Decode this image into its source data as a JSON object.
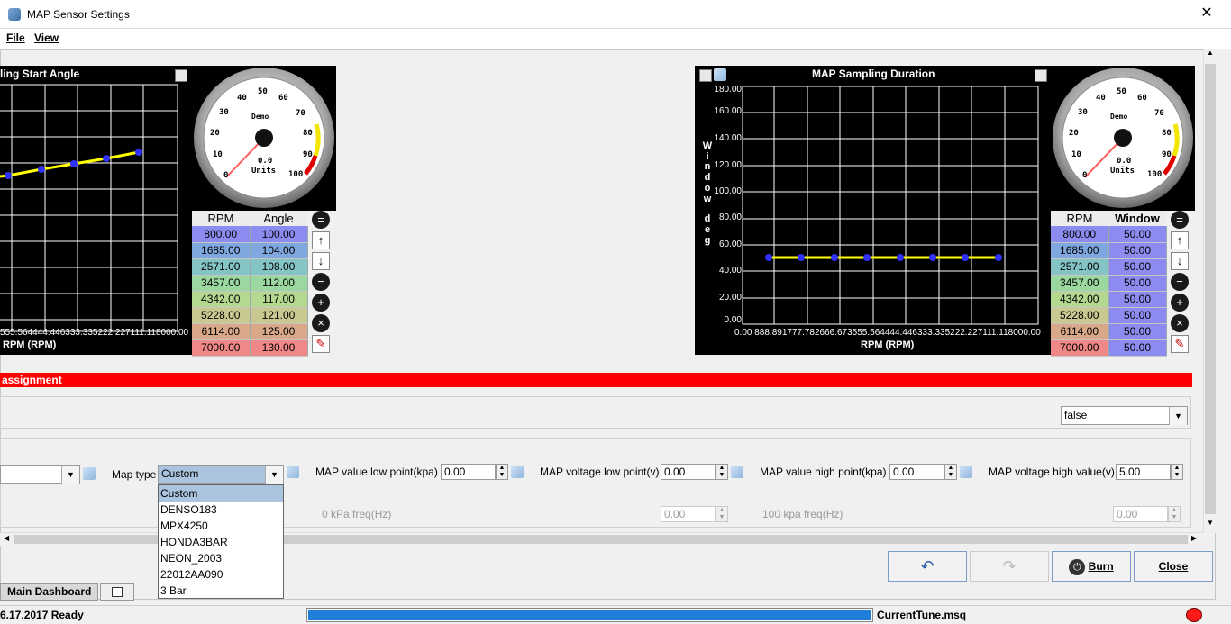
{
  "window": {
    "title": "MAP Sensor Settings",
    "close_glyph": "✕"
  },
  "menu": {
    "file": "File",
    "view": "View"
  },
  "left_chart": {
    "title": "ling Start Angle",
    "x_ticks": [
      "555.56",
      "4444.44",
      "6333.33",
      "5222.22",
      "7111.11",
      "8000.00"
    ],
    "x_tick_text": "555.564444.446333.335222.227111.118000.00",
    "xlabel": "RPM (RPM)",
    "points": [
      810,
      1685,
      2571,
      3457,
      4342
    ]
  },
  "right_chart": {
    "title": "MAP Sampling Duration",
    "y_ticks": [
      "180.00",
      "160.00",
      "140.00",
      "120.00",
      "100.00",
      "80.00",
      "60.00",
      "40.00",
      "20.00",
      "0.00"
    ],
    "ylabel_chars": [
      "W",
      "i",
      "n",
      "d",
      "o",
      "w",
      "",
      "d",
      "e",
      "g"
    ],
    "x_tick_text": "0.00 888.891777.782666.673555.564444.446333.335222.227111.118000.00",
    "xlabel": "RPM (RPM)"
  },
  "gauge": {
    "ticks": [
      "0",
      "10",
      "20",
      "30",
      "40",
      "50",
      "60",
      "70",
      "80",
      "90",
      "100"
    ],
    "label": "Demo",
    "value": "0.0",
    "units": "Units"
  },
  "left_table": {
    "headers": [
      "RPM",
      "Angle"
    ],
    "rows": [
      [
        "800.00",
        "100.00"
      ],
      [
        "1685.00",
        "104.00"
      ],
      [
        "2571.00",
        "108.00"
      ],
      [
        "3457.00",
        "112.00"
      ],
      [
        "4342.00",
        "117.00"
      ],
      [
        "5228.00",
        "121.00"
      ],
      [
        "6114.00",
        "125.00"
      ],
      [
        "7000.00",
        "130.00"
      ]
    ]
  },
  "right_table": {
    "headers": [
      "RPM",
      "Window"
    ],
    "rows": [
      [
        "800.00",
        "50.00"
      ],
      [
        "1685.00",
        "50.00"
      ],
      [
        "2571.00",
        "50.00"
      ],
      [
        "3457.00",
        "50.00"
      ],
      [
        "4342.00",
        "50.00"
      ],
      [
        "5228.00",
        "50.00"
      ],
      [
        "6114.00",
        "50.00"
      ],
      [
        "7000.00",
        "50.00"
      ]
    ]
  },
  "row_colors": [
    "#8c8cf0",
    "#7fa8e0",
    "#84c4c4",
    "#9ad8a0",
    "#b4d890",
    "#c8c890",
    "#d8a888",
    "#f08888"
  ],
  "red_bar": "assignment",
  "false_combo": "false",
  "form": {
    "map_type_label": "Map type",
    "map_type_value": "Custom",
    "map_low_label": "MAP value low point(kpa)",
    "map_low_value": "0.00",
    "volt_low_label": "MAP voltage low point(v)",
    "volt_low_value": "0.00",
    "map_high_label": "MAP value high point(kpa)",
    "map_high_value": "0.00",
    "volt_high_label": "MAP voltage high value(v)",
    "volt_high_value": "5.00",
    "freq0_label": "0 kPa freq(Hz)",
    "freq0_value": "0.00",
    "freq100_label": "100 kpa freq(Hz)",
    "freq100_value": "0.00"
  },
  "dropdown_options": [
    "Custom",
    "DENSO183",
    "MPX4250",
    "HONDA3BAR",
    "NEON_2003",
    "22012AA090",
    "3 Bar"
  ],
  "buttons": {
    "burn": "Burn",
    "close": "Close"
  },
  "tab": "Main Dashboard",
  "status": {
    "left": "6.17.2017 Ready",
    "file": "CurrentTune.msq"
  }
}
